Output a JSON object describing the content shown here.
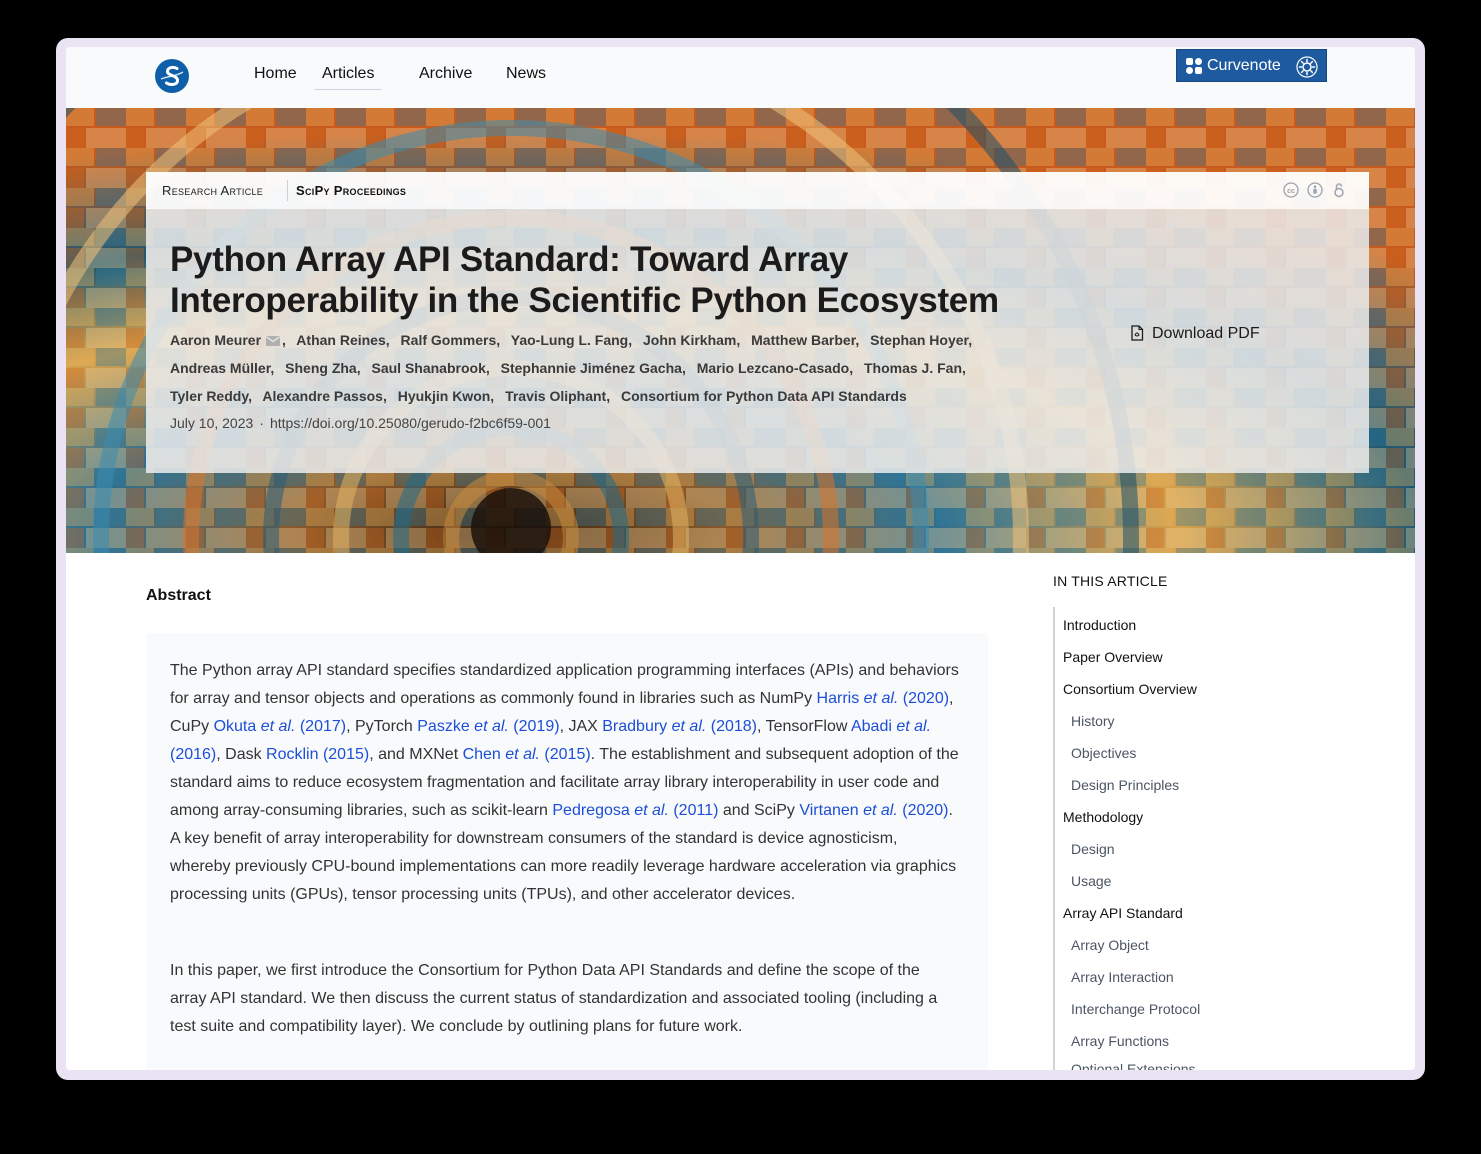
{
  "nav": {
    "links": [
      "Home",
      "Articles",
      "Archive",
      "News"
    ],
    "active": "Articles",
    "badge_label": "Curvenote"
  },
  "colors": {
    "badge": "#1e5aa0",
    "link": "#1d4ed8",
    "logo": "#0e5fa8"
  },
  "icons": {
    "logo": "scipy-logo-icon",
    "badge_logo": "curvenote-logo-icon",
    "badge_gear": "gear-icon",
    "license": [
      "creative-commons-icon",
      "attribution-icon",
      "open-access-icon"
    ],
    "mail": "mail-icon",
    "download": "pdf-file-icon"
  },
  "article": {
    "kind": "Research Article",
    "venue": "SciPy Proceedings",
    "title": "Python Array API Standard: Toward Array Interoperability in the Scientific Python Ecosystem",
    "authors": [
      "Aaron Meurer",
      "Athan Reines",
      "Ralf Gommers",
      "Yao-Lung L. Fang",
      "John Kirkham",
      "Matthew Barber",
      "Stephan Hoyer",
      "Andreas Müller",
      "Sheng Zha",
      "Saul Shanabrook",
      "Stephannie Jiménez Gacha",
      "Mario Lezcano-Casado",
      "Thomas J. Fan",
      "Tyler Reddy",
      "Alexandre Passos",
      "Hyukjin Kwon",
      "Travis Oliphant",
      "Consortium for Python Data API Standards"
    ],
    "date": "July 10, 2023",
    "doi": "https://doi.org/10.25080/gerudo-f2bc6f59-001",
    "download_label": "Download PDF"
  },
  "abstract": {
    "heading": "Abstract",
    "p1": {
      "t1": "The Python array API standard specifies standardized application programming interfaces (APIs) and behaviors for array and tensor objects and operations as commonly found in libraries such as NumPy ",
      "c1a": "Harris ",
      "c1b": "et al.",
      "c1c": " (2020)",
      "t2": ", CuPy ",
      "c2a": "Okuta ",
      "c2b": "et al.",
      "c2c": " (2017)",
      "t3": ", PyTorch ",
      "c3a": "Paszke ",
      "c3b": "et al.",
      "c3c": " (2019)",
      "t4": ", JAX ",
      "c4a": "Bradbury ",
      "c4b": "et al.",
      "c4c": " (2018)",
      "t5": ", TensorFlow ",
      "c5a": "Abadi ",
      "c5b": "et al.",
      "c5c": " (2016)",
      "t6": ", Dask ",
      "c6": "Rocklin (2015)",
      "t7": ", and MXNet ",
      "c7a": "Chen ",
      "c7b": "et al.",
      "c7c": " (2015)",
      "t8": ". The establishment and subsequent adoption of the standard aims to reduce ecosystem fragmentation and facilitate array library interoperability in user code and among array-consuming libraries, such as scikit-learn ",
      "c8a": "Pedregosa ",
      "c8b": "et al.",
      "c8c": " (2011)",
      "t9": " and SciPy ",
      "c9a": "Virtanen ",
      "c9b": "et al.",
      "c9c": " (2020)",
      "t10": ". A key benefit of array interoperability for downstream consumers of the standard is device agnosticism, whereby previously CPU-bound implementations can more readily leverage hardware acceleration via graphics processing units (GPUs), tensor processing units (TPUs), and other accelerator devices."
    },
    "p2": "In this paper, we first introduce the Consortium for Python Data API Standards and define the scope of the array API standard. We then discuss the current status of standardization and associated tooling (including a test suite and compatibility layer). We conclude by outlining plans for future work."
  },
  "toc": {
    "title": "IN THIS ARTICLE",
    "items": [
      {
        "label": "Introduction",
        "level": 1
      },
      {
        "label": "Paper Overview",
        "level": 1
      },
      {
        "label": "Consortium Overview",
        "level": 1
      },
      {
        "label": "History",
        "level": 2
      },
      {
        "label": "Objectives",
        "level": 2
      },
      {
        "label": "Design Principles",
        "level": 2
      },
      {
        "label": "Methodology",
        "level": 1
      },
      {
        "label": "Design",
        "level": 2
      },
      {
        "label": "Usage",
        "level": 2
      },
      {
        "label": "Array API Standard",
        "level": 1
      },
      {
        "label": "Array Object",
        "level": 2
      },
      {
        "label": "Array Interaction",
        "level": 2
      },
      {
        "label": "Interchange Protocol",
        "level": 2
      },
      {
        "label": "Array Functions",
        "level": 2
      },
      {
        "label": "Optional Extensions",
        "level": 2
      }
    ]
  }
}
